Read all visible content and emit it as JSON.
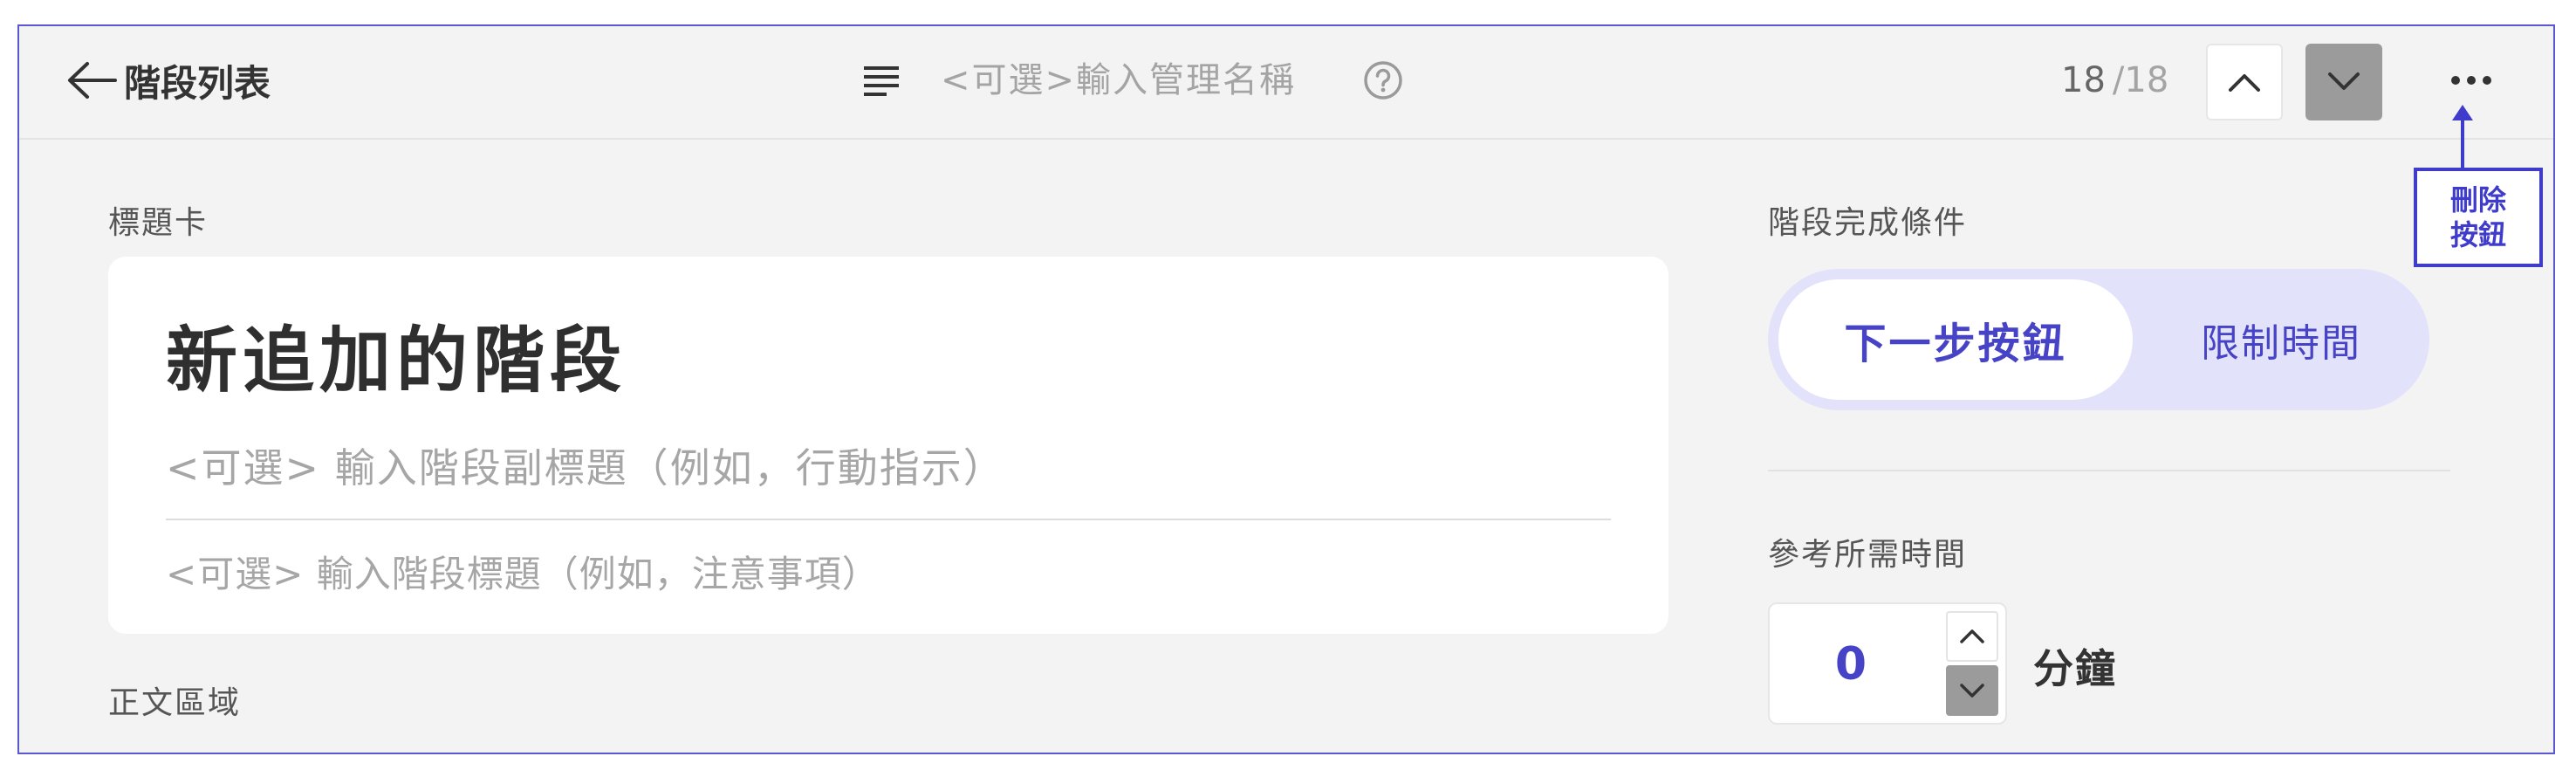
{
  "header": {
    "back_label": "階段列表",
    "management_name_placeholder": "<可選>輸入管理名稱",
    "page_current": "18",
    "page_total_text": "/18"
  },
  "annotation": {
    "line1": "刪除",
    "line2": "按鈕"
  },
  "title_card": {
    "section_label": "標題卡",
    "title": "新追加的階段",
    "subtitle_placeholder": "<可選> 輸入階段副標題（例如，行動指示）",
    "note_placeholder": "<可選> 輸入階段標題（例如，注意事項）"
  },
  "body": {
    "section_label": "正文區域"
  },
  "completion": {
    "section_label": "階段完成條件",
    "options": [
      "下一步按鈕",
      "限制時間"
    ],
    "selected": "下一步按鈕"
  },
  "time": {
    "section_label": "參考所需時間",
    "value": "0",
    "unit": "分鐘"
  },
  "colors": {
    "accent": "#4743c6",
    "annotation": "#3f3ccc",
    "toggle_bg": "#e3e2fb",
    "panel_bg": "#f3f3f3"
  },
  "icons": [
    "back-arrow-icon",
    "text-lines-icon",
    "help-circle-icon",
    "chevron-up-icon",
    "chevron-down-icon",
    "more-horizontal-icon"
  ]
}
